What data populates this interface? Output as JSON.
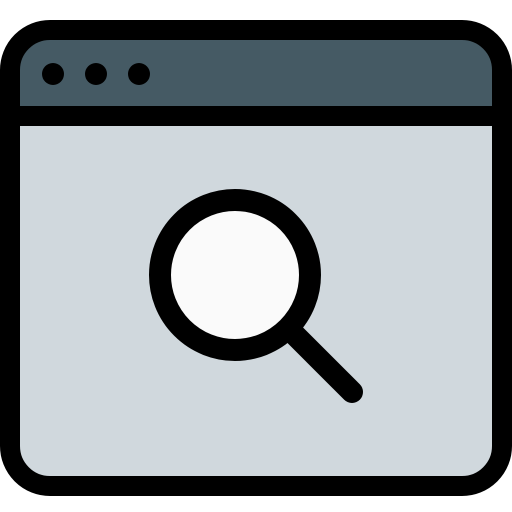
{
  "icon": {
    "name": "browser-window-search-icon",
    "colors": {
      "outline": "#000000",
      "title_bar": "#455a64",
      "window_body": "#d0d8dd",
      "lens": "#fafafa"
    },
    "title_bar": {
      "dots_count": 3
    }
  }
}
